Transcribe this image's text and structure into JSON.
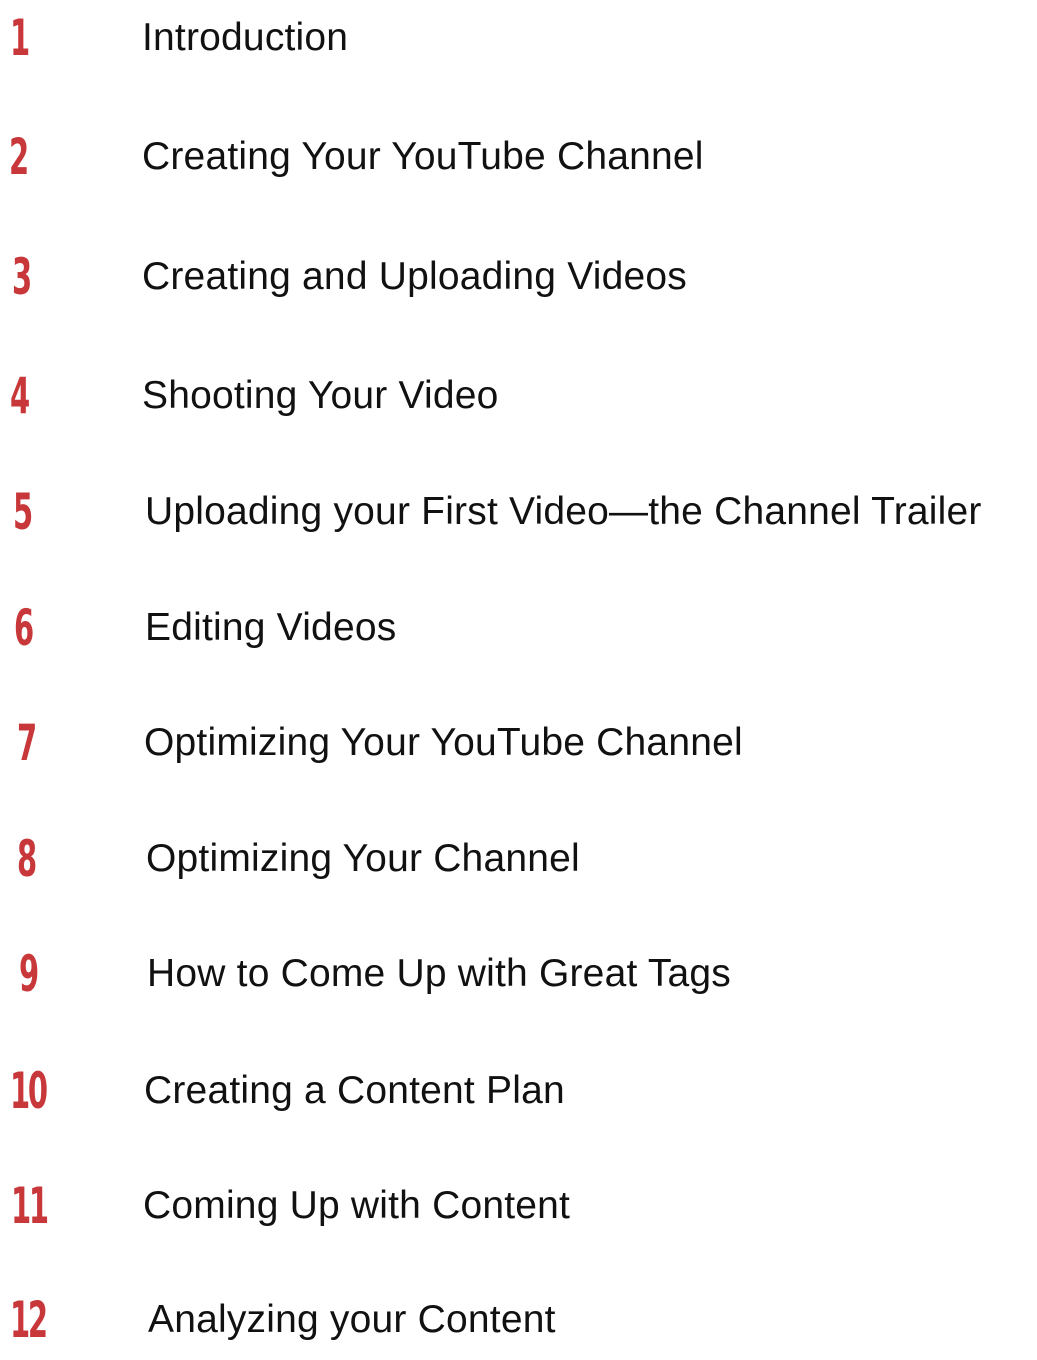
{
  "toc": {
    "entries": [
      {
        "number": "1",
        "title": "Introduction"
      },
      {
        "number": "2",
        "title": "Creating Your YouTube Channel"
      },
      {
        "number": "3",
        "title": "Creating and Uploading Videos"
      },
      {
        "number": "4",
        "title": "Shooting Your Video"
      },
      {
        "number": "5",
        "title": "Uploading your First Video—the Channel Trailer"
      },
      {
        "number": "6",
        "title": "Editing Videos"
      },
      {
        "number": "7",
        "title": "Optimizing Your YouTube Channel"
      },
      {
        "number": "8",
        "title": "Optimizing Your Channel"
      },
      {
        "number": "9",
        "title": "How to Come Up with Great Tags"
      },
      {
        "number": "10",
        "title": "Creating a Content Plan"
      },
      {
        "number": "11",
        "title": "Coming Up with Content"
      },
      {
        "number": "12",
        "title": "Analyzing your Content"
      }
    ],
    "number_color": "#c8383a",
    "title_color": "#111111"
  }
}
